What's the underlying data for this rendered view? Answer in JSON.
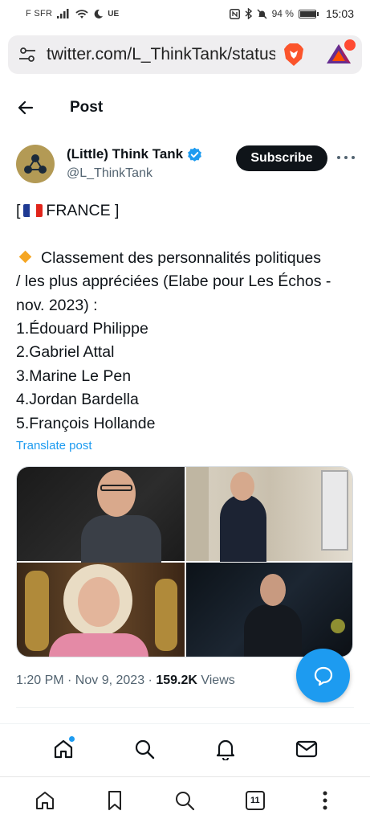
{
  "status_bar": {
    "carrier": "F SFR",
    "network": "UE",
    "battery": "94 %",
    "battery_level": 0.94,
    "time": "15:03"
  },
  "browser": {
    "url": "twitter.com/L_ThinkTank/status"
  },
  "header": {
    "title": "Post"
  },
  "tweet": {
    "author_name": "(Little) Think Tank",
    "handle": "@L_ThinkTank",
    "subscribe_label": "Subscribe",
    "lines": {
      "country_open": "[",
      "country": "FRANCE ]",
      "intro": "Classement des personnalités politiques",
      "intro2": "/ les plus appréciées (Elabe pour Les Échos -",
      "intro3": "nov. 2023) :",
      "r1": "1.Édouard Philippe",
      "r2": "2.Gabriel Attal",
      "r3": "3.Marine Le Pen",
      "r4": "4.Jordan Bardella",
      "r5": "5.François Hollande"
    },
    "translate_label": "Translate post",
    "timestamp": "1:20 PM · Nov 9, 2023 ·",
    "views_count": "159.2K",
    "views_label": "Views"
  },
  "twitter_nav": [
    "home-icon",
    "search-icon",
    "bell-icon",
    "mail-icon"
  ],
  "browser_nav": {
    "tabs_count": "11"
  },
  "colors": {
    "accent": "#1d9bf0",
    "text": "#0f1419",
    "muted": "#536471"
  }
}
